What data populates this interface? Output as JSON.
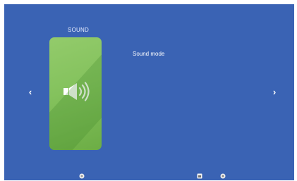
{
  "menu": {
    "category_title": "SOUND",
    "card_icon": "speaker-volume-icon",
    "options": [
      {
        "label": "Sound mode"
      }
    ],
    "nav": {
      "prev_icon": "chevron-left-icon",
      "prev_glyph": "‹",
      "next_icon": "chevron-right-icon",
      "next_glyph": "›"
    }
  },
  "bottom_bar": {
    "icons": [
      "circle-button-icon",
      "square-button-icon",
      "circle-button-icon"
    ]
  },
  "colors": {
    "background": "#3a63b4",
    "card": "#84c25d",
    "text": "#ffffff"
  }
}
